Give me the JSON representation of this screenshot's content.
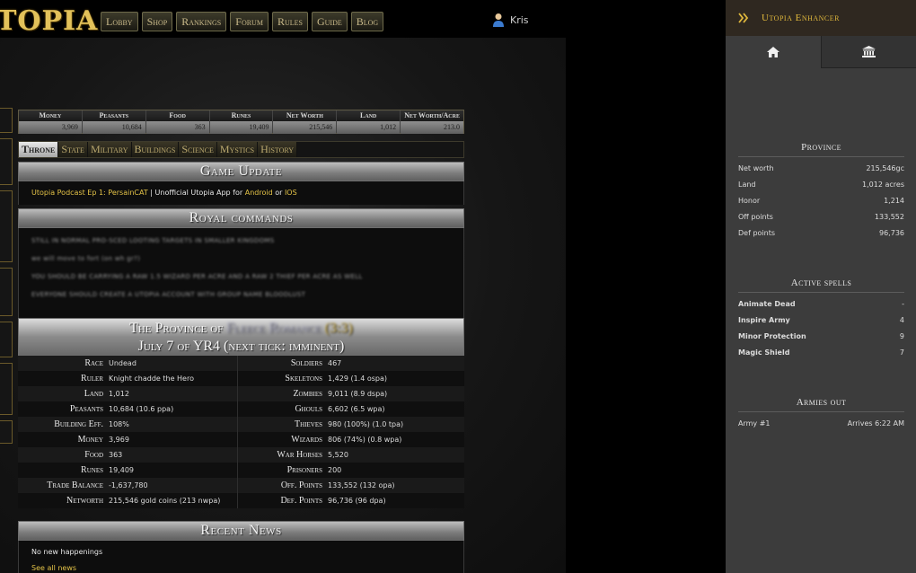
{
  "logo": "TOPIA",
  "nav": [
    "Lobby",
    "Shop",
    "Rankings",
    "Forum",
    "Rules",
    "Guide",
    "Blog"
  ],
  "user": {
    "name": "Kris"
  },
  "resources": [
    {
      "label": "Money",
      "value": "3,969"
    },
    {
      "label": "Peasants",
      "value": "10,684"
    },
    {
      "label": "Food",
      "value": "363"
    },
    {
      "label": "Runes",
      "value": "19,409"
    },
    {
      "label": "Net Worth",
      "value": "215,546"
    },
    {
      "label": "Land",
      "value": "1,012"
    },
    {
      "label": "Net Worth/Acre",
      "value": "213.0"
    }
  ],
  "tabs": [
    "Throne",
    "State",
    "Military",
    "Buildings",
    "Science",
    "Mystics",
    "History"
  ],
  "game_update": {
    "title": "Game Update",
    "link1": "Utopia Podcast Ep 1: PersainCAT",
    "sep": " | Unofficial Utopia App for ",
    "link2": "Android",
    "or": " or ",
    "link3": "IOS"
  },
  "royal": {
    "title": "Royal commands",
    "lines": [
      "STILL IN NORMAL PRO-SCED LOOTING TARGETS IN SMALLER KINGDOMS",
      "we will move to fort (on wh gr?)",
      "YOU SHOULD BE CARRYING A RAW 1.5 WIZARD PER ACRE AND A RAW 2 THIEF PER ACRE AS WELL",
      "EVERYONE SHOULD CREATE A UTOPIA ACCOUNT WITH GROUP NAME BLOODLUST"
    ]
  },
  "province": {
    "prefix": "The Province of",
    "name": "Fleece Romance",
    "kingdom": "(3:3)",
    "date_line": "July 7 of YR4  (next tick: imminent)",
    "rows": [
      {
        "l1": "Race",
        "v1": "Undead",
        "l2": "Soldiers",
        "v2": "467"
      },
      {
        "l1": "Ruler",
        "v1": "Knight chadde the Hero",
        "l2": "Skeletons",
        "v2": "1,429 (1.4 ospa)"
      },
      {
        "l1": "Land",
        "v1": "1,012",
        "l2": "Zombies",
        "v2": "9,011 (8.9 dspa)"
      },
      {
        "l1": "Peasants",
        "v1": "10,684 (10.6 ppa)",
        "l2": "Ghouls",
        "v2": "6,602 (6.5 wpa)"
      },
      {
        "l1": "Building Eff.",
        "v1": "108%",
        "l2": "Thieves",
        "v2": "980 (100%) (1.0 tpa)"
      },
      {
        "l1": "Money",
        "v1": "3,969",
        "l2": "Wizards",
        "v2": "806 (74%) (0.8 wpa)"
      },
      {
        "l1": "Food",
        "v1": "363",
        "l2": "War Horses",
        "v2": "5,520"
      },
      {
        "l1": "Runes",
        "v1": "19,409",
        "l2": "Prisoners",
        "v2": "200"
      },
      {
        "l1": "Trade Balance",
        "v1": "-1,637,780",
        "l2": "Off. Points",
        "v2": "133,552 (132 opa)"
      },
      {
        "l1": "Networth",
        "v1": "215,546 gold coins (213 nwpa)",
        "l2": "Def. Points",
        "v2": "96,736 (96 dpa)"
      }
    ]
  },
  "news": {
    "title": "Recent News",
    "empty": "No new happenings",
    "link": "See all news"
  },
  "enhancer": {
    "title": "Utopia Enhancer",
    "province_title": "Province",
    "province_rows": [
      {
        "k": "Net worth",
        "v": "215,546gc"
      },
      {
        "k": "Land",
        "v": "1,012 acres"
      },
      {
        "k": "Honor",
        "v": "1,214"
      },
      {
        "k": "Off points",
        "v": "133,552"
      },
      {
        "k": "Def points",
        "v": "96,736"
      }
    ],
    "spells_title": "Active spells",
    "spells": [
      {
        "k": "Animate Dead",
        "v": "-"
      },
      {
        "k": "Inspire Army",
        "v": "4"
      },
      {
        "k": "Minor Protection",
        "v": "9"
      },
      {
        "k": "Magic Shield",
        "v": "7"
      }
    ],
    "armies_title": "Armies out",
    "armies": [
      {
        "k": "Army #1",
        "v": "Arrives 6:22 AM"
      }
    ]
  },
  "colors": {
    "gold": "#e2c15a",
    "link": "#e3c247",
    "panel": "#3c3c3c"
  }
}
